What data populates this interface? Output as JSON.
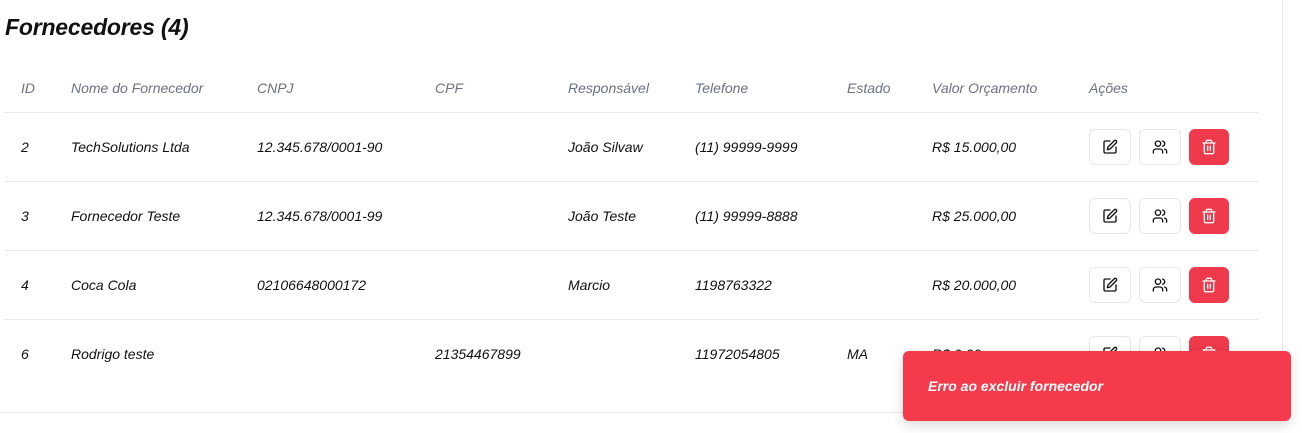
{
  "page": {
    "title": "Fornecedores (4)"
  },
  "table": {
    "columns": [
      "ID",
      "Nome do Fornecedor",
      "CNPJ",
      "CPF",
      "Responsável",
      "Telefone",
      "Estado",
      "Valor Orçamento",
      "Ações"
    ],
    "rows": [
      {
        "id": "2",
        "nome": "TechSolutions Ltda",
        "cnpj": "12.345.678/0001-90",
        "cpf": "",
        "responsavel": "João Silvaw",
        "telefone": "(11) 99999-9999",
        "estado": "",
        "valor": "R$ 15.000,00"
      },
      {
        "id": "3",
        "nome": "Fornecedor Teste",
        "cnpj": "12.345.678/0001-99",
        "cpf": "",
        "responsavel": "João Teste",
        "telefone": "(11) 99999-8888",
        "estado": "",
        "valor": "R$ 25.000,00"
      },
      {
        "id": "4",
        "nome": "Coca Cola",
        "cnpj": "02106648000172",
        "cpf": "",
        "responsavel": "Marcio",
        "telefone": "1198763322",
        "estado": "",
        "valor": "R$ 20.000,00"
      },
      {
        "id": "6",
        "nome": "Rodrigo teste",
        "cnpj": "",
        "cpf": "21354467899",
        "responsavel": "",
        "telefone": "11972054805",
        "estado": "MA",
        "valor": "R$ 0,00"
      }
    ],
    "action_icons": {
      "edit": "edit-icon",
      "contacts": "users-icon",
      "delete": "trash-icon"
    }
  },
  "toast": {
    "message": "Erro ao excluir fornecedor"
  },
  "colors": {
    "danger": "#ef3a4b",
    "toast": "#f43a4b",
    "border": "#e5e7eb",
    "header_text": "#6b7280"
  }
}
